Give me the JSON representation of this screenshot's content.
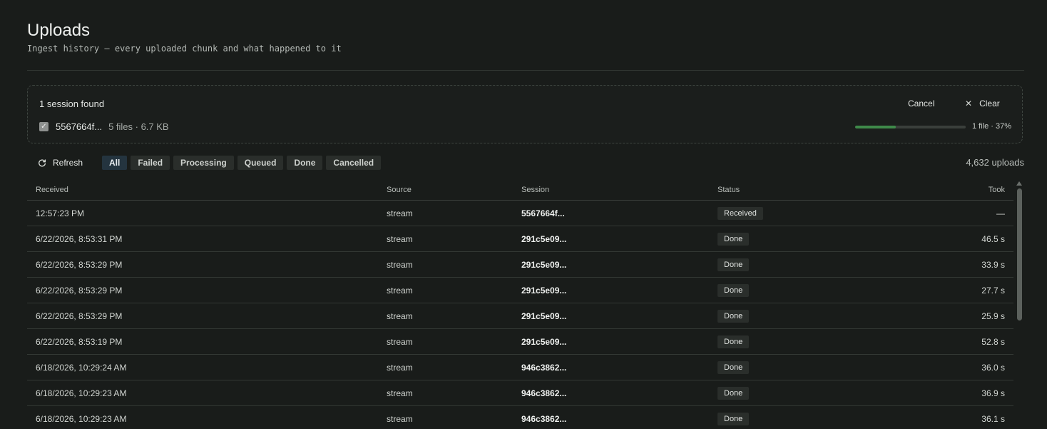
{
  "header": {
    "title": "Uploads",
    "subtitle": "Ingest history — every uploaded chunk and what happened to it"
  },
  "session_panel": {
    "count_label": "1 session found",
    "cancel_label": "Cancel",
    "clear_label": "Clear",
    "clear_icon": "close-icon",
    "session_id": "5567664f...",
    "session_meta": "5 files · 6.7 KB",
    "checkbox_checked": true,
    "progress_label": "1 file · 37%",
    "progress_fraction": 0.37,
    "progress_color": "#3f8a4a"
  },
  "toolbar": {
    "refresh_label": "Refresh",
    "refresh_icon": "refresh-icon",
    "filters": [
      "All",
      "Failed",
      "Processing",
      "Queued",
      "Done",
      "Cancelled"
    ],
    "active_filter": "All",
    "upload_count": "4,632 uploads"
  },
  "table": {
    "columns": [
      "Received",
      "Source",
      "Session",
      "Status",
      "Took"
    ],
    "rows": [
      {
        "received": "12:57:23 PM",
        "source": "stream",
        "session": "5567664f...",
        "status": "Received",
        "took": "—"
      },
      {
        "received": "6/22/2026, 8:53:31 PM",
        "source": "stream",
        "session": "291c5e09...",
        "status": "Done",
        "took": "46.5 s"
      },
      {
        "received": "6/22/2026, 8:53:29 PM",
        "source": "stream",
        "session": "291c5e09...",
        "status": "Done",
        "took": "33.9 s"
      },
      {
        "received": "6/22/2026, 8:53:29 PM",
        "source": "stream",
        "session": "291c5e09...",
        "status": "Done",
        "took": "27.7 s"
      },
      {
        "received": "6/22/2026, 8:53:29 PM",
        "source": "stream",
        "session": "291c5e09...",
        "status": "Done",
        "took": "25.9 s"
      },
      {
        "received": "6/22/2026, 8:53:19 PM",
        "source": "stream",
        "session": "291c5e09...",
        "status": "Done",
        "took": "52.8 s"
      },
      {
        "received": "6/18/2026, 10:29:24 AM",
        "source": "stream",
        "session": "946c3862...",
        "status": "Done",
        "took": "36.0 s"
      },
      {
        "received": "6/18/2026, 10:29:23 AM",
        "source": "stream",
        "session": "946c3862...",
        "status": "Done",
        "took": "36.9 s"
      },
      {
        "received": "6/18/2026, 10:29:23 AM",
        "source": "stream",
        "session": "946c3862...",
        "status": "Done",
        "took": "36.1 s"
      }
    ]
  }
}
